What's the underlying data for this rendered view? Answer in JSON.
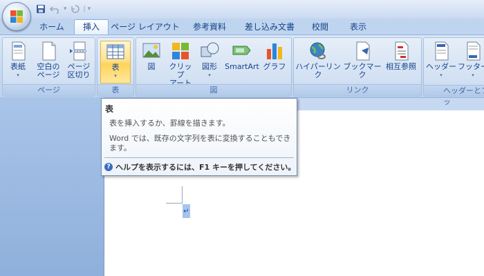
{
  "titlebar": {},
  "tabs": [
    "ホーム",
    "挿入",
    "ページ レイアウト",
    "参考資料",
    "差し込み文書",
    "校閲",
    "表示"
  ],
  "active_tab": "挿入",
  "ribbon": {
    "groups": {
      "page": {
        "label": "ページ",
        "buttons": {
          "cover": "表紙",
          "blank": "空白の\nページ",
          "break": "ページ\n区切り"
        }
      },
      "table": {
        "label": "表",
        "buttons": {
          "table": "表"
        }
      },
      "illustrations": {
        "label": "図",
        "buttons": {
          "picture": "図",
          "clipart": "クリップ\nアート",
          "shapes": "図形",
          "smartart": "SmartArt",
          "chart": "グラフ"
        }
      },
      "links": {
        "label": "リンク",
        "buttons": {
          "hyperlink": "ハイパーリンク",
          "bookmark": "ブックマーク",
          "crossref": "相互参照"
        }
      },
      "header_footer": {
        "label": "ヘッダーとフッ",
        "buttons": {
          "header": "ヘッダー",
          "footer": "フッター"
        }
      }
    }
  },
  "tooltip": {
    "title": "表",
    "description": "表を挿入するか、罫線を描きます。",
    "detail": "Word では、既存の文字列を表に変換することもできます。",
    "help": "ヘルプを表示するには、F1 キーを押してください。"
  },
  "document": {
    "paragraph_mark": "↵"
  },
  "colors": {
    "ribbon": "#dbe6f5",
    "tab_text": "#15428b",
    "highlight": "#ffd35c"
  }
}
